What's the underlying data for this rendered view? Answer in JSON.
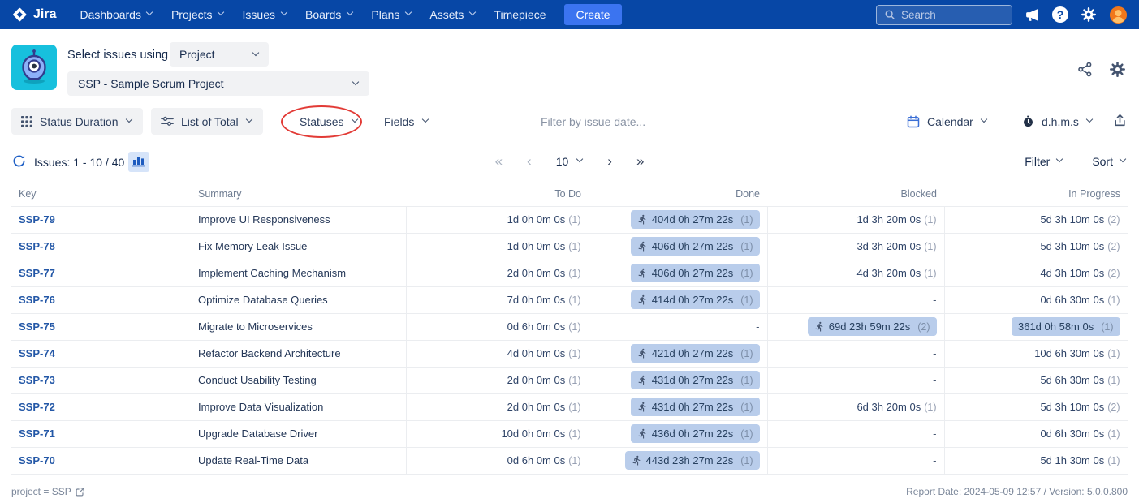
{
  "topnav": {
    "logo_text": "Jira",
    "items": [
      {
        "label": "Dashboards",
        "chevron": true
      },
      {
        "label": "Projects",
        "chevron": true
      },
      {
        "label": "Issues",
        "chevron": true
      },
      {
        "label": "Boards",
        "chevron": true
      },
      {
        "label": "Plans",
        "chevron": true
      },
      {
        "label": "Assets",
        "chevron": true
      },
      {
        "label": "Timepiece",
        "chevron": false
      }
    ],
    "create_label": "Create",
    "search_placeholder": "Search"
  },
  "header": {
    "select_issues_label": "Select issues using",
    "issue_scope_value": "Project",
    "project_value": "SSP - Sample Scrum Project"
  },
  "toolbar": {
    "report_type_label": "Status Duration",
    "list_type_label": "List of Total",
    "statuses_label": "Statuses",
    "fields_label": "Fields",
    "date_filter_placeholder": "Filter by issue date...",
    "calendar_label": "Calendar",
    "time_format_label": "d.h.m.s"
  },
  "pagination": {
    "issues_count_label": "Issues: 1 - 10 / 40",
    "page_size_value": "10",
    "filter_label": "Filter",
    "sort_label": "Sort"
  },
  "icons_text": {
    "first": "«",
    "prev": "‹",
    "next": "›",
    "last": "»",
    "help": "?"
  },
  "table": {
    "columns": [
      "Key",
      "Summary",
      "To Do",
      "Done",
      "Blocked",
      "In Progress"
    ],
    "rows": [
      {
        "key": "SSP-79",
        "summary": "Improve UI Responsiveness",
        "cells": [
          {
            "value": "1d 0h 0m 0s",
            "count": "(1)",
            "highlight": false,
            "runner": false
          },
          {
            "value": "404d 0h 27m 22s",
            "count": "(1)",
            "highlight": true,
            "runner": true
          },
          {
            "value": "1d 3h 20m 0s",
            "count": "(1)",
            "highlight": false,
            "runner": false
          },
          {
            "value": "5d 3h 10m 0s",
            "count": "(2)",
            "highlight": false,
            "runner": false
          }
        ]
      },
      {
        "key": "SSP-78",
        "summary": "Fix Memory Leak Issue",
        "cells": [
          {
            "value": "1d 0h 0m 0s",
            "count": "(1)",
            "highlight": false,
            "runner": false
          },
          {
            "value": "406d 0h 27m 22s",
            "count": "(1)",
            "highlight": true,
            "runner": true
          },
          {
            "value": "3d 3h 20m 0s",
            "count": "(1)",
            "highlight": false,
            "runner": false
          },
          {
            "value": "5d 3h 10m 0s",
            "count": "(2)",
            "highlight": false,
            "runner": false
          }
        ]
      },
      {
        "key": "SSP-77",
        "summary": "Implement Caching Mechanism",
        "cells": [
          {
            "value": "2d 0h 0m 0s",
            "count": "(1)",
            "highlight": false,
            "runner": false
          },
          {
            "value": "406d 0h 27m 22s",
            "count": "(1)",
            "highlight": true,
            "runner": true
          },
          {
            "value": "4d 3h 20m 0s",
            "count": "(1)",
            "highlight": false,
            "runner": false
          },
          {
            "value": "4d 3h 10m 0s",
            "count": "(2)",
            "highlight": false,
            "runner": false
          }
        ]
      },
      {
        "key": "SSP-76",
        "summary": "Optimize Database Queries",
        "cells": [
          {
            "value": "7d 0h 0m 0s",
            "count": "(1)",
            "highlight": false,
            "runner": false
          },
          {
            "value": "414d 0h 27m 22s",
            "count": "(1)",
            "highlight": true,
            "runner": true
          },
          {
            "value": "-",
            "count": "",
            "highlight": false,
            "runner": false
          },
          {
            "value": "0d 6h 30m 0s",
            "count": "(1)",
            "highlight": false,
            "runner": false
          }
        ]
      },
      {
        "key": "SSP-75",
        "summary": "Migrate to Microservices",
        "cells": [
          {
            "value": "0d 6h 0m 0s",
            "count": "(1)",
            "highlight": false,
            "runner": false
          },
          {
            "value": "-",
            "count": "",
            "highlight": false,
            "runner": false
          },
          {
            "value": "69d 23h 59m 22s",
            "count": "(2)",
            "highlight": true,
            "runner": true
          },
          {
            "value": "361d 0h 58m 0s",
            "count": "(1)",
            "highlight": true,
            "runner": false
          }
        ]
      },
      {
        "key": "SSP-74",
        "summary": "Refactor Backend Architecture",
        "cells": [
          {
            "value": "4d 0h 0m 0s",
            "count": "(1)",
            "highlight": false,
            "runner": false
          },
          {
            "value": "421d 0h 27m 22s",
            "count": "(1)",
            "highlight": true,
            "runner": true
          },
          {
            "value": "-",
            "count": "",
            "highlight": false,
            "runner": false
          },
          {
            "value": "10d 6h 30m 0s",
            "count": "(1)",
            "highlight": false,
            "runner": false
          }
        ]
      },
      {
        "key": "SSP-73",
        "summary": "Conduct Usability Testing",
        "cells": [
          {
            "value": "2d 0h 0m 0s",
            "count": "(1)",
            "highlight": false,
            "runner": false
          },
          {
            "value": "431d 0h 27m 22s",
            "count": "(1)",
            "highlight": true,
            "runner": true
          },
          {
            "value": "-",
            "count": "",
            "highlight": false,
            "runner": false
          },
          {
            "value": "5d 6h 30m 0s",
            "count": "(1)",
            "highlight": false,
            "runner": false
          }
        ]
      },
      {
        "key": "SSP-72",
        "summary": "Improve Data Visualization",
        "cells": [
          {
            "value": "2d 0h 0m 0s",
            "count": "(1)",
            "highlight": false,
            "runner": false
          },
          {
            "value": "431d 0h 27m 22s",
            "count": "(1)",
            "highlight": true,
            "runner": true
          },
          {
            "value": "6d 3h 20m 0s",
            "count": "(1)",
            "highlight": false,
            "runner": false
          },
          {
            "value": "5d 3h 10m 0s",
            "count": "(2)",
            "highlight": false,
            "runner": false
          }
        ]
      },
      {
        "key": "SSP-71",
        "summary": "Upgrade Database Driver",
        "cells": [
          {
            "value": "10d 0h 0m 0s",
            "count": "(1)",
            "highlight": false,
            "runner": false
          },
          {
            "value": "436d 0h 27m 22s",
            "count": "(1)",
            "highlight": true,
            "runner": true
          },
          {
            "value": "-",
            "count": "",
            "highlight": false,
            "runner": false
          },
          {
            "value": "0d 6h 30m 0s",
            "count": "(1)",
            "highlight": false,
            "runner": false
          }
        ]
      },
      {
        "key": "SSP-70",
        "summary": "Update Real-Time Data",
        "cells": [
          {
            "value": "0d 6h 0m 0s",
            "count": "(1)",
            "highlight": false,
            "runner": false
          },
          {
            "value": "443d 23h 27m 22s",
            "count": "(1)",
            "highlight": true,
            "runner": true
          },
          {
            "value": "-",
            "count": "",
            "highlight": false,
            "runner": false
          },
          {
            "value": "5d 1h 30m 0s",
            "count": "(1)",
            "highlight": false,
            "runner": false
          }
        ]
      }
    ]
  },
  "footer": {
    "query_label": "project = SSP",
    "report_info": "Report Date: 2024-05-09 12:57 / Version: 5.0.0.800"
  }
}
